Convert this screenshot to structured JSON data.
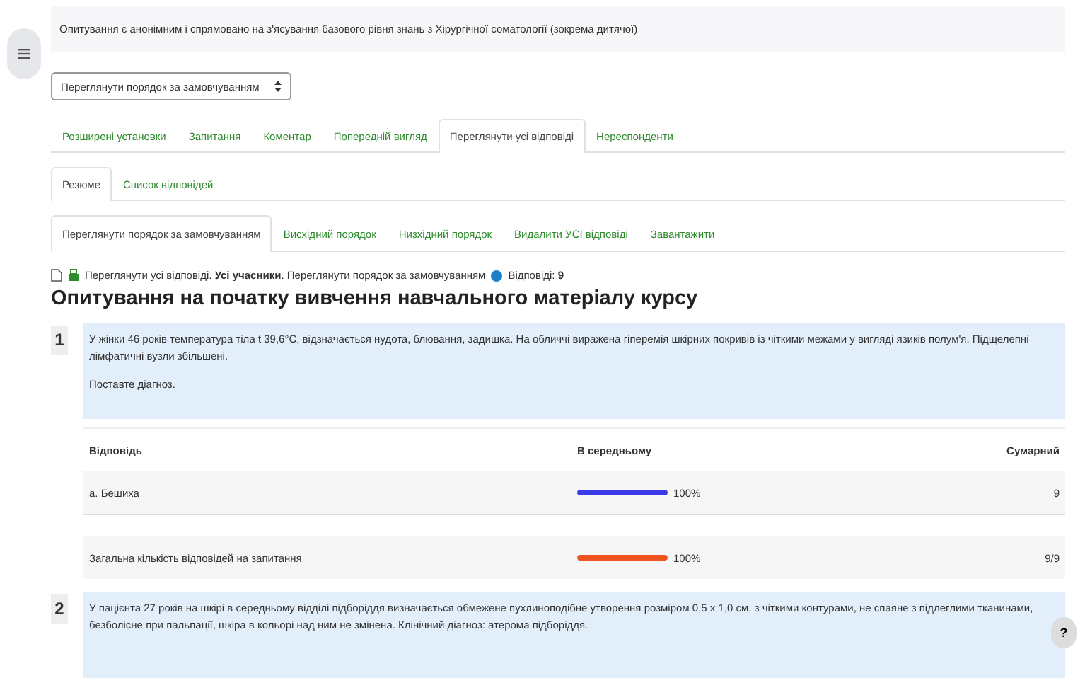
{
  "intro": "Опитування є анонімним і спрямовано на з'ясування базового рівня знань з Хірургічної соматології (зокрема дитячої)",
  "order_select": {
    "value": "Переглянути порядок за замовчуванням"
  },
  "tabs": [
    {
      "label": "Розширені установки",
      "selected": false
    },
    {
      "label": "Запитання",
      "selected": false
    },
    {
      "label": "Коментар",
      "selected": false
    },
    {
      "label": "Попередній вигляд",
      "selected": false
    },
    {
      "label": "Переглянути усі відповіді",
      "selected": true
    },
    {
      "label": "Нереспонденти",
      "selected": false
    }
  ],
  "subtabs": [
    {
      "label": "Резюме",
      "selected": true
    },
    {
      "label": "Список відповідей",
      "selected": false
    }
  ],
  "order_tabs": [
    {
      "label": "Переглянути порядок за замовчуванням",
      "selected": true
    },
    {
      "label": "Висхідний порядок",
      "selected": false
    },
    {
      "label": "Низхідний порядок",
      "selected": false
    },
    {
      "label": "Видалити УСІ відповіді",
      "selected": false
    },
    {
      "label": "Завантажити",
      "selected": false
    }
  ],
  "info_line": "Переглянути усі відповіді. **Усі учасники**. Переглянути порядок за замовчуванням",
  "responses": "Відповіді: **9**",
  "title": "Опитування на початку вивчення навчального матеріалу курсу",
  "questions": [
    {
      "number": "1",
      "text": "У жінки 46 років температура тіла t 39,6°C, відзначається нудота, блювання, задишка. На обличчі виражена гіперемія шкірних покривів із чіткими межами у вигляді язиків полум'я. Підщелепні лімфатичні вузли збільшені.",
      "text_2": "Поставте діагноз.",
      "table": {
        "columns": [
          "Відповідь",
          "В середньому",
          "Сумарний"
        ],
        "rows": [
          {
            "kind": "answer",
            "label": "a. Бешиха",
            "level": 1.0,
            "color": "#3a3ae8",
            "percent": "100%",
            "total": "9"
          },
          {
            "kind": "total",
            "label": "Загальна кількість відповідей на запитання",
            "level": 1.0,
            "color": "#f0541e",
            "percent": "100%",
            "total": "9/9"
          }
        ]
      }
    },
    {
      "number": "2",
      "text": "У пацієнта 27 років на шкірі в середньому відділі підборіддя визначається обмежене пухлиноподібне утворення розміром 0,5 х 1,0 см, з чіткими контурами, не спаяне з підлеглими тканинами, безболісне при пальпації, шкіра в кольорі над ним не змінена. Клінічний діагноз: атерома підборіддя."
    }
  ],
  "help_button": "?"
}
